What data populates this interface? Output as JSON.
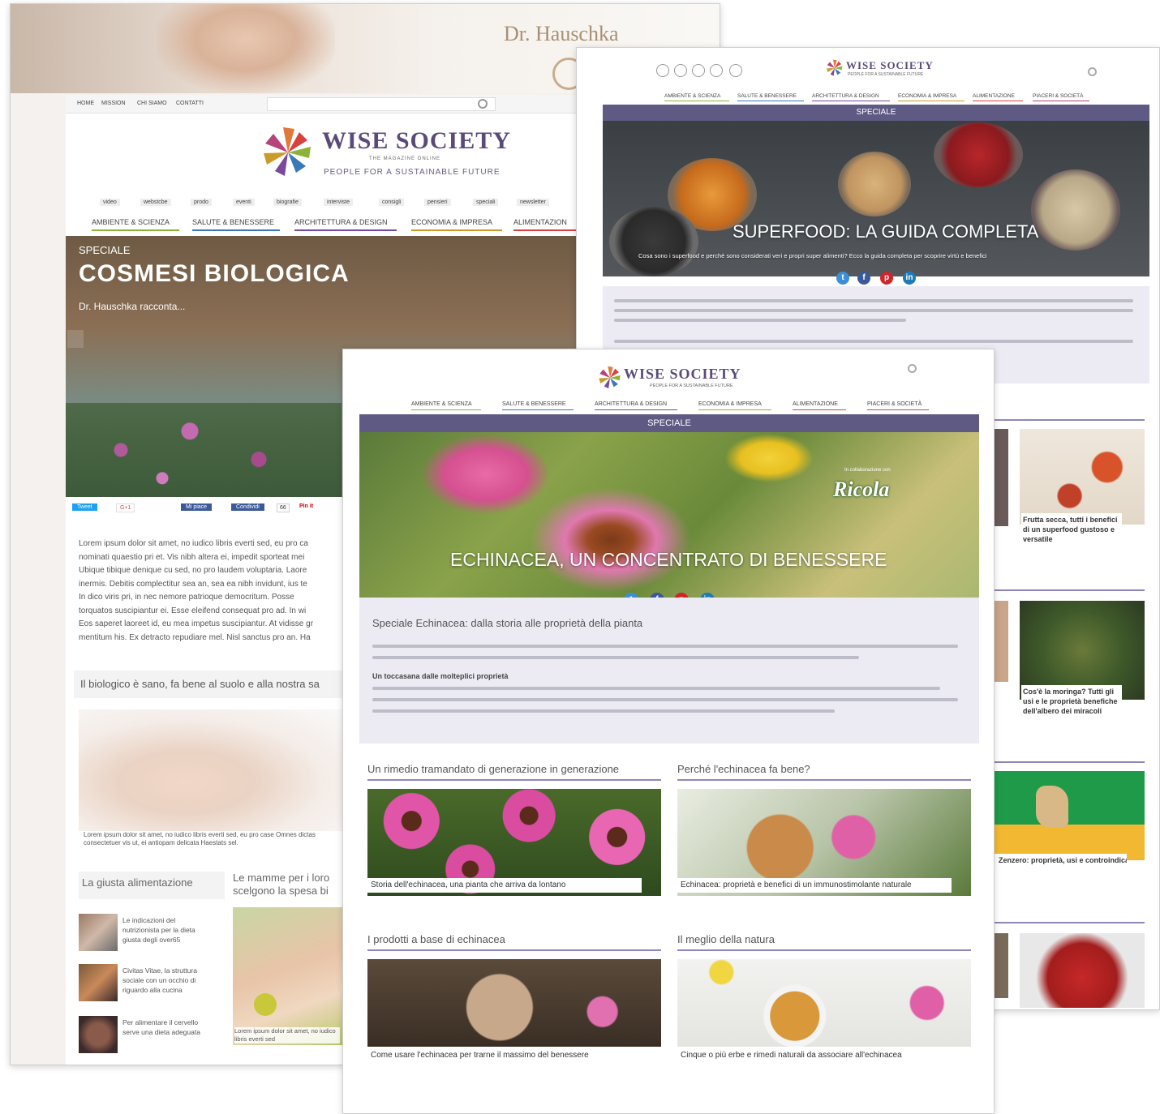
{
  "back": {
    "brand": "Dr. Hauschka",
    "topnav": [
      "HOME",
      "MISSION",
      "CHI SIAMO",
      "CONTATTI"
    ],
    "logo_title": "WISE SOCIETY",
    "logo_tag1": "THE MAGAZINE ONLINE",
    "logo_tag2": "PEOPLE FOR A SUSTAINABLE FUTURE",
    "subnav": [
      "video",
      "webstcbe",
      "prodo",
      "eventi",
      "biografie",
      "interviste",
      "consigli",
      "pensieri",
      "speciali",
      "newsletter"
    ],
    "mainnav": [
      "AMBIENTE & SCIENZA",
      "SALUTE & BENESSERE",
      "ARCHITETTURA & DESIGN",
      "ECONOMIA & IMPRESA",
      "ALIMENTAZION"
    ],
    "hero_kicker": "SPECIALE",
    "hero_title": "COSMESI BIOLOGICA",
    "hero_sub": "Dr. Hauschka racconta...",
    "share": [
      "Tweet",
      "G+1",
      "Mi piace",
      "Condividi",
      "Pin it"
    ],
    "share_count": "66",
    "body_lines": [
      "Lorem ipsum dolor sit amet, no iudico libris everti sed, eu pro ca",
      "nominati quaestio pri et. Vis nibh altera ei, impedit sporteat mei",
      "Ubique tibique denique cu sed, no pro laudem voluptaria. Laore",
      "inermis. Debitis complectitur sea an, sea ea nibh invidunt, ius te",
      "In dico viris pri, in nec nemore patrioque democritum. Posse",
      "torquatos suscipiantur ei. Esse eleifend consequat pro ad. In wi",
      "Eos saperet laoreet id, eu mea impetus suscipiantur. At vidisse gr",
      "mentitum his. Ex detracto repudiare mel. Nisl sanctus pro an. Ha"
    ],
    "quote": "Il biologico è sano, fa bene al suolo e alla nostra sa",
    "baby_caption": "Lorem ipsum dolor sit amet, no iudico libris everti sed, eu pro case Omnes dictas consectetuer vis ut, ei antiopam delicata Haestats sel.",
    "col1_title": "La giusta alimentazione",
    "col2_title": "Le mamme per i loro scelgono la spesa bi",
    "col1_items": [
      "Le indicazioni del nutrizionista per la dieta giusta degli over65",
      "Civitas Vitae, la struttura sociale con un occhio di riguardo alla cucina",
      "Per alimentare il cervello serve una dieta adeguata"
    ],
    "col2_caption": "Lorem ipsum dolor sit amet, no iudico libris everti sed"
  },
  "mid": {
    "logo_title": "WISE SOCIETY",
    "logo_tag": "PEOPLE FOR A SUSTAINABLE FUTURE",
    "nav": [
      "AMBIENTE & SCIENZA",
      "SALUTE & BENESSERE",
      "ARCHITETTURA & DESIGN",
      "ECONOMIA & IMPRESA",
      "ALIMENTAZIONE",
      "PIACERI & SOCIETÀ"
    ],
    "speciale": "SPECIALE",
    "hero_title": "SUPERFOOD: LA GUIDA COMPLETA",
    "hero_sub": "Cosa sono i superfood e perché sono considerati veri e propri super alimenti? Ecco la guida completa per scoprire virtù e benefici",
    "side_items": [
      "Frutta secca, tutti i benefici di un superfood gustoso e versatile",
      "Cos'è la moringa? Tutti gli usi e le proprietà benefiche dell'albero dei miracoli",
      "Zenzero: proprietà, usi e controindicazioni"
    ]
  },
  "front": {
    "logo_title": "WISE SOCIETY",
    "logo_tag": "PEOPLE FOR A SUSTAINABLE FUTURE",
    "nav": [
      "AMBIENTE & SCIENZA",
      "SALUTE & BENESSERE",
      "ARCHITETTURA & DESIGN",
      "ECONOMIA & IMPRESA",
      "ALIMENTAZIONE",
      "PIACERI & SOCIETÀ"
    ],
    "speciale": "SPECIALE",
    "partner_label": "In collaborazione con",
    "partner": "Ricola",
    "hero_title": "ECHINACEA, UN CONCENTRATO DI BENESSERE",
    "intro_title": "Speciale Echinacea: dalla storia alle proprietà della pianta",
    "sub_heading": "Un toccasana dalle molteplici proprietà",
    "sections": [
      {
        "title": "Un rimedio tramandato di generazione in generazione",
        "caption": "Storia dell'echinacea, una pianta che arriva da lontano"
      },
      {
        "title": "Perché l'echinacea fa bene?",
        "caption": "Echinacea: proprietà e benefici di un immunostimolante naturale"
      },
      {
        "title": "I prodotti a base di echinacea",
        "caption": "Come usare l'echinacea per trarne il massimo del benessere"
      },
      {
        "title": "Il meglio della natura",
        "caption": "Cinque o più erbe e rimedi naturali da associare all'echinacea"
      }
    ]
  },
  "colors": {
    "purple": "#5e5a84",
    "twitter": "#3b8fd8",
    "facebook": "#3b5998",
    "pinterest": "#d0242b",
    "linkedin": "#1f7bb6"
  }
}
